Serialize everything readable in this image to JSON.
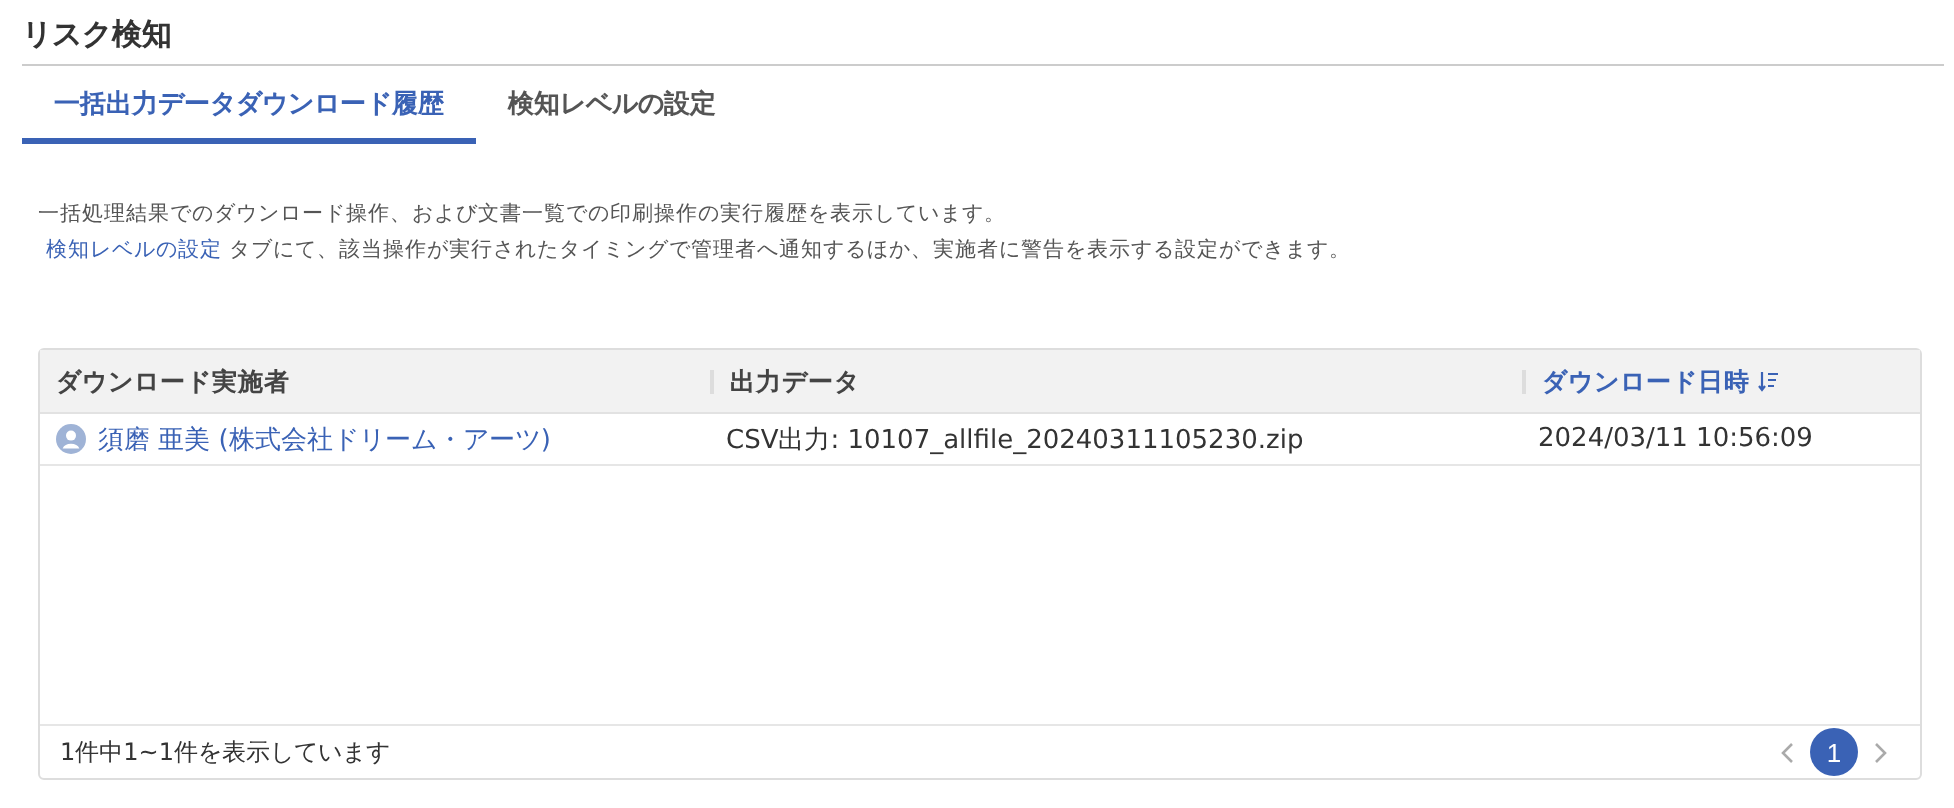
{
  "page_title": "リスク検知",
  "tabs": [
    {
      "label": "一括出力データダウンロード履歴",
      "selected": true
    },
    {
      "label": "検知レベルの設定",
      "selected": false
    }
  ],
  "description": {
    "line_1": "一括処理結果でのダウンロード操作、および文書一覧での印刷操作の実行履歴を表示しています。",
    "link": "検知レベルの設定",
    "line_2_rest": " タブにて、該当操作が実行されたタイミングで管理者へ通知するほか、実施者に警告を表示する設定ができます。"
  },
  "table": {
    "columns": [
      {
        "label": "ダウンロード実施者",
        "sorted": false
      },
      {
        "label": "出力データ",
        "sorted": false
      },
      {
        "label": "ダウンロード日時",
        "sorted": true
      }
    ],
    "rows": [
      {
        "user": "須磨 亜美 (株式会社ドリーム・アーツ)",
        "output": "CSV出力: 10107_allfile_20240311105230.zip",
        "datetime": "2024/03/11 10:56:09"
      }
    ],
    "footer": "1件中1~1件を表示しています",
    "pages": [
      {
        "label": "1",
        "selected": true
      }
    ]
  }
}
